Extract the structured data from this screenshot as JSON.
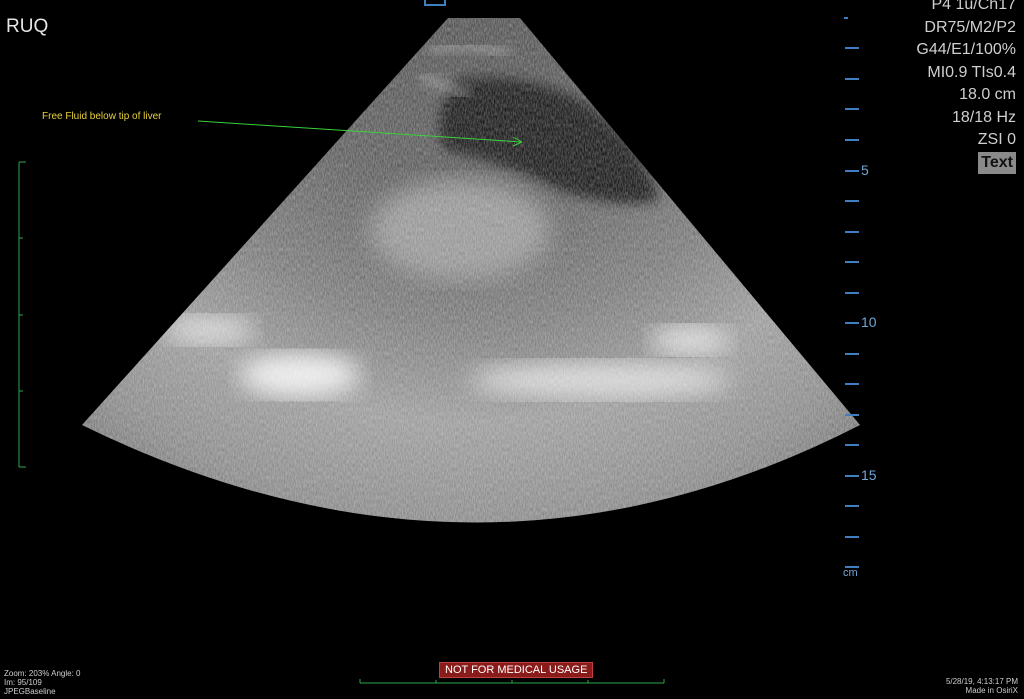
{
  "region": "RUQ",
  "parameters": [
    "P4 1u/Ch17",
    "DR75/M2/P2",
    "G44/E1/100%",
    "MI0.9  TIs0.4",
    "18.0 cm",
    "18/18 Hz",
    "ZSI 0"
  ],
  "text_button": "Text",
  "annotation": "Free Fluid below tip of liver",
  "depth_scale": {
    "labels": [
      "5",
      "10",
      "15"
    ],
    "unit": "cm"
  },
  "zoom_info": [
    "Zoom: 203%  Angle: 0",
    "Im: 95/109",
    "JPEGBaseline"
  ],
  "date_info": [
    "5/28/19, 4:13:17 PM",
    "Made in OsiriX"
  ],
  "warning": "NOT FOR MEDICAL USAGE",
  "colors": {
    "scale": "#3d7fbf",
    "annotation_text": "#e8d23a",
    "arrow": "#3ad23a",
    "left_ruler": "#2ea84a",
    "warning_bg": "#8a1b1b"
  }
}
